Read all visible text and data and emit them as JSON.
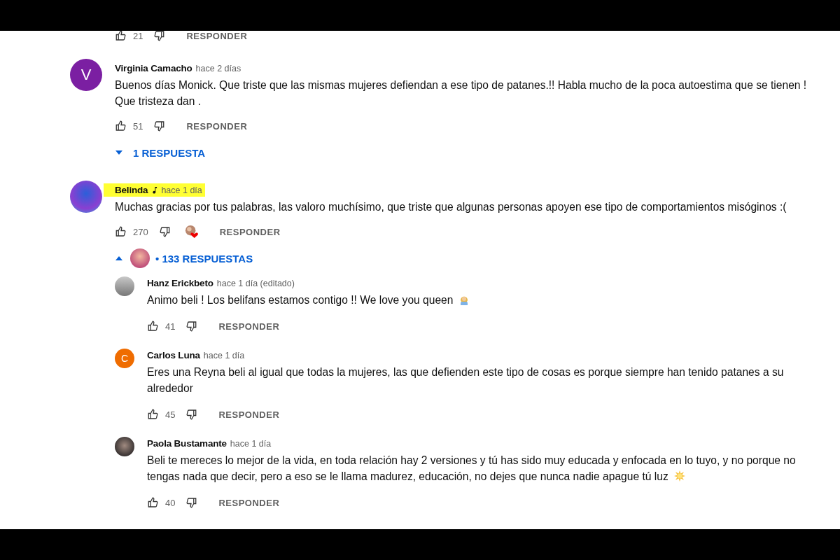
{
  "top_actions": {
    "likes": "21",
    "reply": "RESPONDER"
  },
  "comments": [
    {
      "author": "Virginia Camacho",
      "time": "hace 2 días",
      "avatar": {
        "kind": "letter",
        "letter": "V",
        "color": "#7b1fa2"
      },
      "highlighted": false,
      "artist_badge": false,
      "text": "Buenos días Monick. Que triste que las mismas mujeres defiendan a ese tipo de patanes.!! Habla mucho de la poca autoestima que se tienen ! Que tristeza dan .",
      "likes": "51",
      "creator_heart": false,
      "reply": "RESPONDER",
      "replies_toggle": {
        "expanded": false,
        "label": "1 RESPUESTA",
        "creator_avatar": false
      }
    },
    {
      "author": "Belinda",
      "time": "hace 1 día",
      "avatar": {
        "kind": "photo"
      },
      "highlighted": true,
      "artist_badge": true,
      "text": "Muchas gracias por tus palabras, las valoro muchísimo, que triste que algunas personas apoyen ese tipo de comportamientos misóginos :(",
      "likes": "270",
      "creator_heart": true,
      "reply": "RESPONDER",
      "replies_toggle": {
        "expanded": true,
        "label": "• 133 RESPUESTAS",
        "creator_avatar": true
      },
      "replies": [
        {
          "author": "Hanz Erickbeto",
          "time": "hace 1 día (editado)",
          "avatar": {
            "kind": "photo"
          },
          "text": "Animo  beli ! Los belifans estamos contigo !! We love you queen",
          "emoji": {
            "kind": "person"
          },
          "likes": "41",
          "reply": "RESPONDER"
        },
        {
          "author": "Carlos Luna",
          "time": "hace 1 día",
          "avatar": {
            "kind": "letter",
            "letter": "C",
            "color": "#ef6c00"
          },
          "text": "Eres una Reyna beli al igual que todas la mujeres, las que defienden este tipo de cosas es porque siempre han tenido patanes a su alrededor",
          "likes": "45",
          "reply": "RESPONDER"
        },
        {
          "author": "Paola Bustamante",
          "time": "hace 1 día",
          "avatar": {
            "kind": "photo"
          },
          "text": "Beli te mereces lo mejor de la vida, en toda relación hay 2 versiones y tú has sido muy educada y enfocada en lo tuyo, y no porque no tengas nada que decir, pero a eso se le llama madurez, educación, no dejes que nunca nadie apague tú luz",
          "emoji": {
            "kind": "sun"
          },
          "likes": "40",
          "reply": "RESPONDER"
        }
      ]
    }
  ]
}
